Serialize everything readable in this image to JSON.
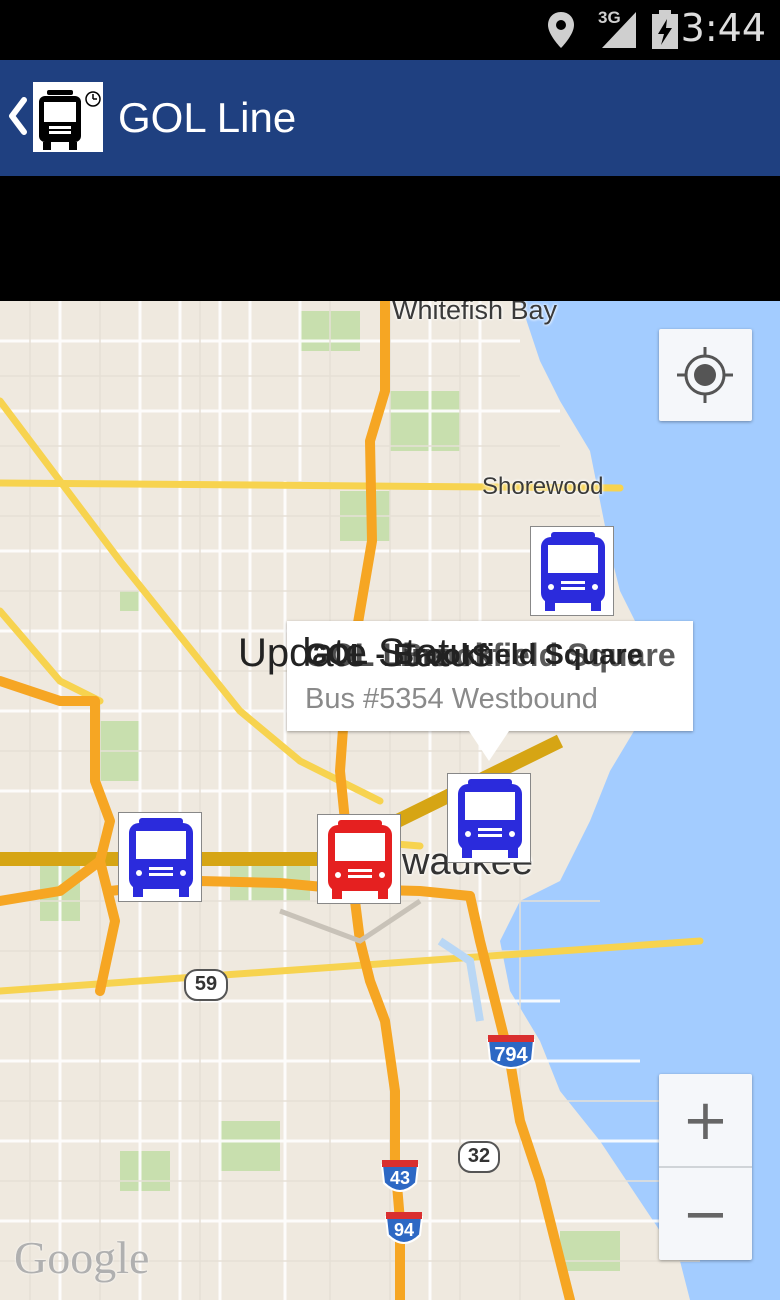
{
  "status_bar": {
    "time": "3:44",
    "network": "3G",
    "icons": [
      "location-icon",
      "signal-icon",
      "battery-icon"
    ]
  },
  "action_bar": {
    "title": "GOL Line",
    "back_icon": "chevron-left-icon",
    "app_icon": "bus-clock-icon",
    "color": "#1f4080"
  },
  "map": {
    "places": [
      "Whitefish Bay",
      "Shorewood",
      "waukee",
      "Mi"
    ],
    "overlay_texts": [
      "Update Status",
      "GOL Line",
      "Brookfield Square"
    ],
    "highways": [
      "59",
      "794",
      "32",
      "43",
      "94"
    ],
    "info_window": {
      "title": "GOL - Brookfield Square",
      "subtitle": "Bus #5354 Westbound"
    },
    "markers": [
      {
        "name": "bus-marker-shorewood",
        "color": "#2b2bdc"
      },
      {
        "name": "bus-marker-selected",
        "color": "#2b2bdc"
      },
      {
        "name": "bus-marker-west",
        "color": "#2b2bdc"
      },
      {
        "name": "bus-marker-red",
        "color": "#e52020"
      }
    ],
    "controls": {
      "my_location_icon": "my-location-icon",
      "zoom_in": "+",
      "zoom_out": "−"
    },
    "attribution": "Google"
  }
}
